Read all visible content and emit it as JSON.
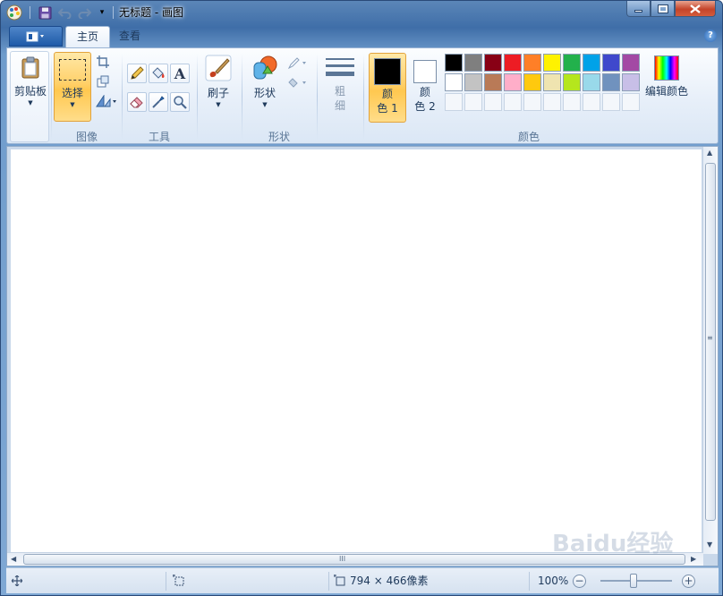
{
  "window": {
    "title": "无标题 - 画图",
    "controls": {
      "minimize": "minimize",
      "maximize": "maximize",
      "close": "close"
    }
  },
  "quick_access": {
    "icons": [
      "paint-app-icon",
      "save-icon",
      "undo-icon",
      "redo-icon",
      "customize-dropdown-icon"
    ]
  },
  "tabs": [
    {
      "label": "主页",
      "active": true
    },
    {
      "label": "查看",
      "active": false
    }
  ],
  "ribbon": {
    "clipboard": {
      "label": "剪贴板"
    },
    "image": {
      "group_label": "图像",
      "select_label": "选择",
      "small_icons": [
        "crop-icon",
        "resize-icon",
        "rotate-icon"
      ]
    },
    "tools": {
      "group_label": "工具",
      "icons": [
        "pencil-icon",
        "fill-bucket-icon",
        "text-icon",
        "eraser-icon",
        "color-picker-icon",
        "magnifier-icon"
      ],
      "text_glyph": "A"
    },
    "brushes": {
      "label": "刷子"
    },
    "shapes": {
      "group_label": "形状",
      "label": "形状",
      "small_icons": [
        "outline-icon",
        "fill-icon"
      ]
    },
    "size": {
      "label_line1": "粗",
      "label_line2": "细"
    },
    "colors": {
      "group_label": "颜色",
      "color1": {
        "label_line1": "颜",
        "label_line2": "色 1",
        "value": "#000000"
      },
      "color2": {
        "label_line1": "颜",
        "label_line2": "色 2",
        "value": "#ffffff"
      },
      "edit_label": "编辑颜色",
      "palette_row1": [
        "#000000",
        "#7f7f7f",
        "#880015",
        "#ed1c24",
        "#ff7f27",
        "#fff200",
        "#22b14c",
        "#00a2e8",
        "#3f48cc",
        "#a349a4"
      ],
      "palette_row2": [
        "#ffffff",
        "#c3c3c3",
        "#b97a57",
        "#ffaec9",
        "#ffc90e",
        "#efe4b0",
        "#b5e61d",
        "#99d9ea",
        "#7092be",
        "#c8bfe7"
      ],
      "palette_row3_count": 10
    }
  },
  "help": {
    "glyph": "?"
  },
  "scrollbars": {
    "grip": "III",
    "grip_v": "≡"
  },
  "status": {
    "canvas_size": "794 × 466像素",
    "zoom": "100%"
  },
  "watermark": {
    "text": "Baidu经验"
  }
}
